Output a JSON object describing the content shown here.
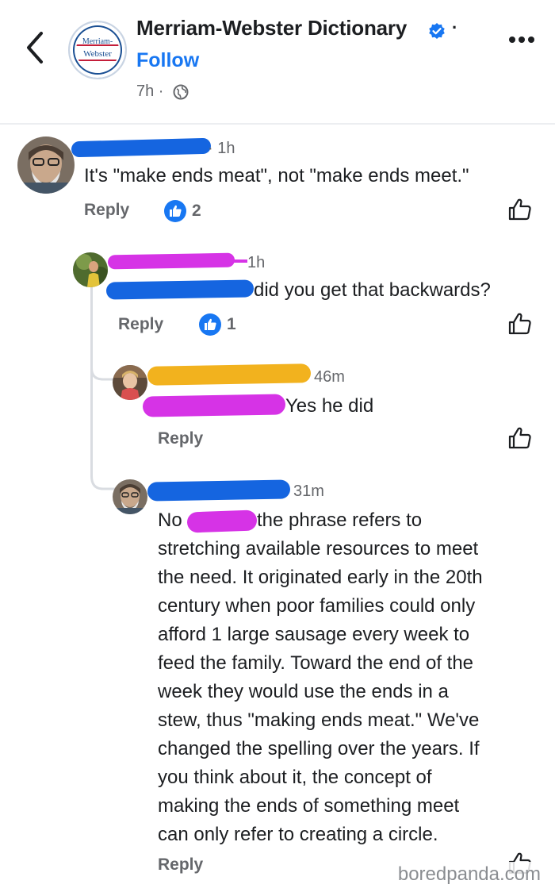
{
  "header": {
    "page_name": "Merriam-Webster Dictionary",
    "follow_label": "Follow",
    "time": "7h ·",
    "logo_text_1": "Merriam-",
    "logo_text_2": "Webster",
    "separator": "·"
  },
  "comments": [
    {
      "time": "· 1h",
      "body": "It's \"make ends meat\", not \"make ends meet.\"",
      "reply_label": "Reply",
      "like_count": "2"
    },
    {
      "time": "1h",
      "body": "did you get that backwards?",
      "reply_label": "Reply",
      "like_count": "1"
    },
    {
      "time": "46m",
      "body": "Yes he did",
      "reply_label": "Reply"
    },
    {
      "time": "31m",
      "body_prefix": "No",
      "body_line1": "the phrase refers to",
      "body_lines": [
        "stretching available resources to meet",
        "the need. It originated early in the 20th",
        "century when poor families could only",
        "afford 1 large sausage every week to",
        "feed the family. Toward the end of the",
        "week they would use the ends in a",
        "stew, thus \"making ends meat.\" We've",
        "changed the spelling over the years. If",
        "you think about it, the concept of",
        "making the ends of something meet",
        "can only refer to creating a circle."
      ],
      "reply_label": "Reply"
    }
  ],
  "watermark": "boredpanda.com",
  "colors": {
    "accent": "#1877f2",
    "redact_blue": "#1565e0",
    "redact_magenta": "#d633e6",
    "redact_orange": "#f2b21e"
  },
  "icons": [
    "back-arrow-icon",
    "verified-badge-icon",
    "more-icon",
    "globe-icon",
    "like-icon",
    "thumbs-up-outline-icon"
  ]
}
